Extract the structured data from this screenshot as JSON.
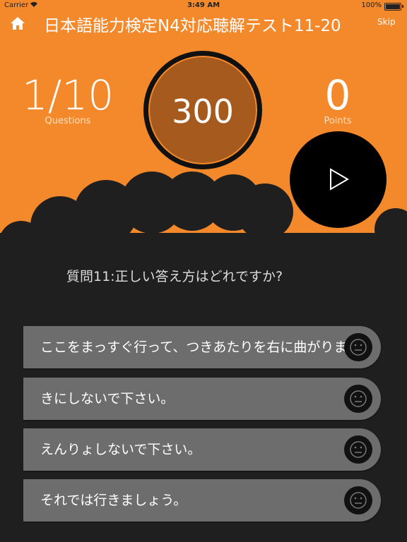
{
  "status_bar": {
    "carrier": "Carrier",
    "time": "3:49 AM",
    "battery": "100%"
  },
  "header": {
    "title": "日本語能力検定N4対応聴解テスト11-20",
    "skip": "Skip"
  },
  "stats": {
    "questions_value": "1/10",
    "questions_label": "Questions",
    "points_value": "0",
    "points_label": "Points"
  },
  "timer": {
    "value": "300"
  },
  "question": {
    "text": "質問11:正しい答え方はどれですか?"
  },
  "answers": [
    {
      "text": "ここをまっすぐ行って、つきあたりを右に曲がります。"
    },
    {
      "text": "きにしないで下さい。"
    },
    {
      "text": "えんりょしないで下さい。"
    },
    {
      "text": "それでは行きましょう。"
    }
  ],
  "colors": {
    "accent": "#f4892b",
    "dark": "#1f1f1f",
    "answer_bg": "#6d6d6d",
    "timer_fill": "#a65a1d"
  },
  "icons": {
    "home": "home-icon",
    "play": "play-icon",
    "face": "neutral-face-icon",
    "wifi": "wifi-icon",
    "battery": "battery-icon"
  }
}
